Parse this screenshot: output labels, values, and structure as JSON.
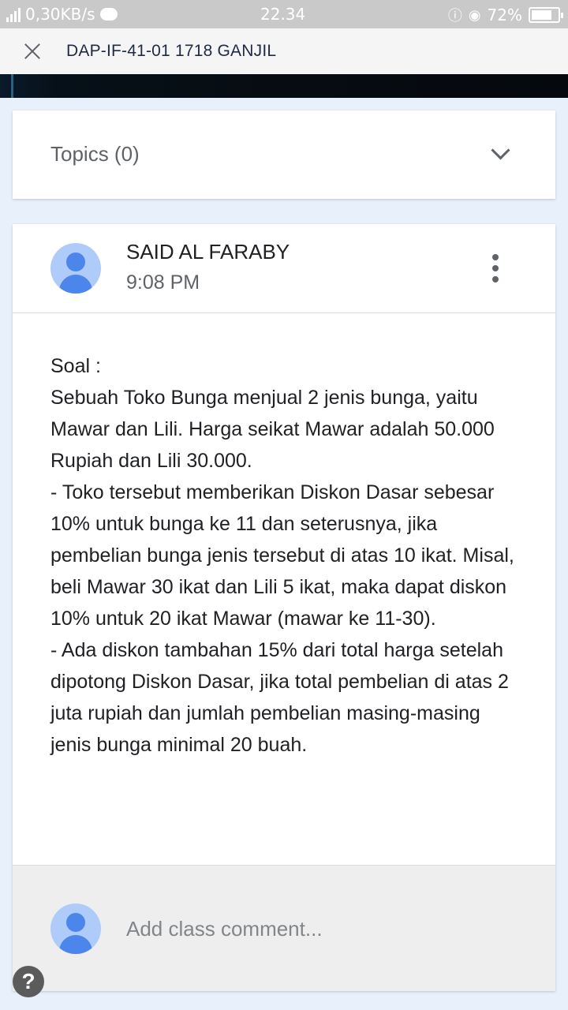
{
  "status_bar": {
    "network_speed": "0,30KB/s",
    "time": "22.34",
    "battery": "72%"
  },
  "app_bar": {
    "title": "DAP-IF-41-01 1718 GANJIL"
  },
  "topics": {
    "label": "Topics (0)"
  },
  "post": {
    "author": "SAID AL FARABY",
    "time": "9:08 PM",
    "lines": [
      "Soal :",
      "Sebuah Toko Bunga menjual 2 jenis bunga, yaitu Mawar dan Lili. Harga seikat Mawar adalah 50.000 Rupiah dan Lili 30.000.",
      "- Toko tersebut memberikan Diskon Dasar sebesar 10% untuk bunga ke 11 dan seterusnya, jika pembelian bunga jenis tersebut di atas 10 ikat. Misal, beli Mawar 30 ikat dan Lili 5 ikat, maka dapat diskon 10% untuk 20 ikat Mawar (mawar ke 11-30).",
      "- Ada diskon tambahan 15% dari total harga setelah dipotong Diskon Dasar, jika total pembelian di atas 2 juta rupiah dan jumlah pembelian masing-masing jenis bunga minimal 20 buah."
    ]
  },
  "comment": {
    "placeholder": "Add class comment..."
  },
  "help": {
    "label": "?"
  },
  "colors": {
    "accent_avatar": "#4c86ea",
    "avatar_bg": "#aecbfa",
    "page_bg": "#e8f0fb"
  }
}
